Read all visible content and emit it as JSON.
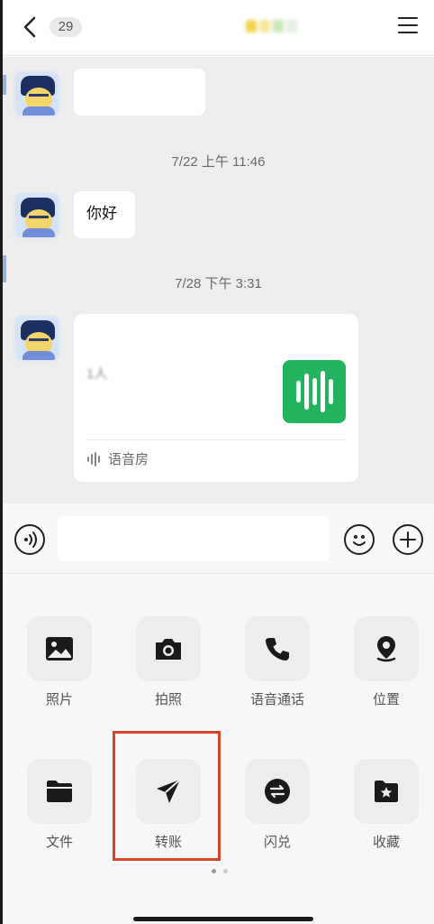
{
  "header": {
    "unread_count": "29",
    "title": "",
    "back_icon": "chevron-left-icon",
    "menu_icon": "hamburger-menu-icon"
  },
  "chat": {
    "messages": [
      {
        "type": "text",
        "text": "",
        "blurred": true
      },
      {
        "type": "timestamp",
        "text": "7/22 上午 11:46"
      },
      {
        "type": "text",
        "text": "你好",
        "blurred": false
      },
      {
        "type": "timestamp",
        "text": "7/28 下午 3:31"
      },
      {
        "type": "card",
        "title": "",
        "subtitle": "1人",
        "footer_icon": "audio-wave-icon",
        "footer_label": "语音房"
      }
    ]
  },
  "input_bar": {
    "voice_icon": "voice-input-icon",
    "placeholder": "",
    "emoji_icon": "emoji-icon",
    "plus_icon": "plus-icon"
  },
  "actions": [
    {
      "label": "照片",
      "icon": "photo-icon"
    },
    {
      "label": "拍照",
      "icon": "camera-icon"
    },
    {
      "label": "语音通话",
      "icon": "phone-icon"
    },
    {
      "label": "位置",
      "icon": "location-pin-icon"
    },
    {
      "label": "文件",
      "icon": "folder-icon"
    },
    {
      "label": "转账",
      "icon": "send-arrow-icon"
    },
    {
      "label": "闪兑",
      "icon": "exchange-icon"
    },
    {
      "label": "收藏",
      "icon": "favorites-star-icon"
    }
  ],
  "colors": {
    "accent_green": "#21b35e",
    "highlight_red": "#d2452a",
    "chat_background": "#ededed"
  },
  "pager": {
    "current_page": 1,
    "total_pages": 2
  }
}
